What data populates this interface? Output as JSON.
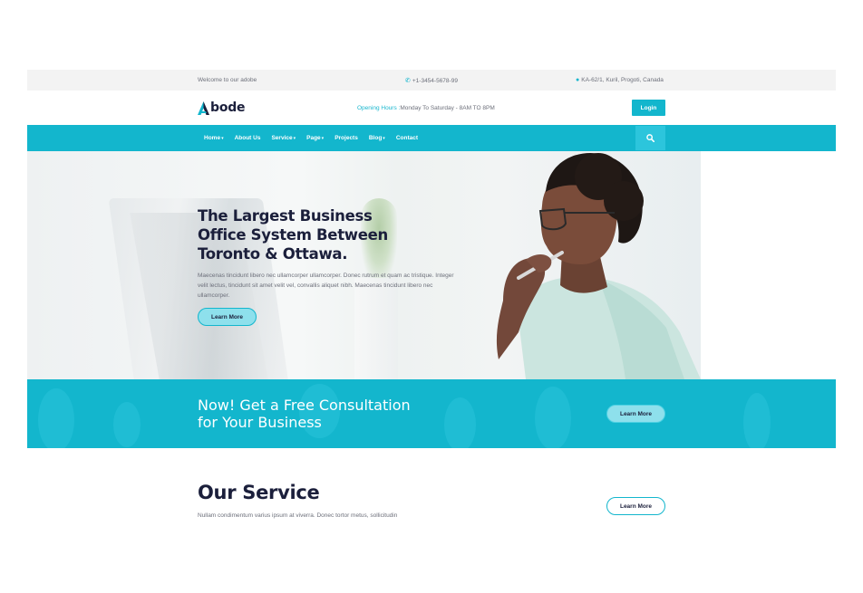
{
  "colors": {
    "accent": "#13b6cd",
    "dark": "#1b1f3b",
    "muted": "#6c6f7a",
    "topbar_bg": "#f3f3f3"
  },
  "topbar": {
    "welcome": "Welcome to our adobe",
    "phone": "+1-3454-5678-99",
    "phone_icon": "phone-icon",
    "address": "KA-62/1, Kuril, Progoti, Canada",
    "address_icon": "map-pin-icon"
  },
  "header": {
    "logo_text": "bode",
    "hours_label": "Opening Hours :",
    "hours_value": "Monday To Saturday - 8AM TO 8PM",
    "login_label": "Login"
  },
  "nav": {
    "items": [
      {
        "label": "Home",
        "dropdown": true
      },
      {
        "label": "About Us",
        "dropdown": false
      },
      {
        "label": "Service",
        "dropdown": true
      },
      {
        "label": "Page",
        "dropdown": true
      },
      {
        "label": "Projects",
        "dropdown": false
      },
      {
        "label": "Blog",
        "dropdown": true
      },
      {
        "label": "Contact",
        "dropdown": false
      }
    ],
    "search_icon": "search-icon"
  },
  "hero": {
    "title_line1": "The Largest Business",
    "title_line2": "Office System Between",
    "title_line3": "Toronto & Ottawa.",
    "text": "Maecenas tincidunt libero nec ullamcorper ullamcorper. Donec rutrum et quam ac tristique. Integer velit lectus, tincidunt sit amet velit vel, convallis aliquet nibh. Maecenas tincidunt libero nec ullamcorper.",
    "button_label": "Learn More"
  },
  "cta": {
    "title_line1": "Now! Get a Free Consultation",
    "title_line2": "for Your Business",
    "button_label": "Learn More"
  },
  "services": {
    "title": "Our Service",
    "text": "Nullam condimentum varius ipsum at viverra. Donec tortor metus, sollicitudin",
    "button_label": "Learn More"
  }
}
